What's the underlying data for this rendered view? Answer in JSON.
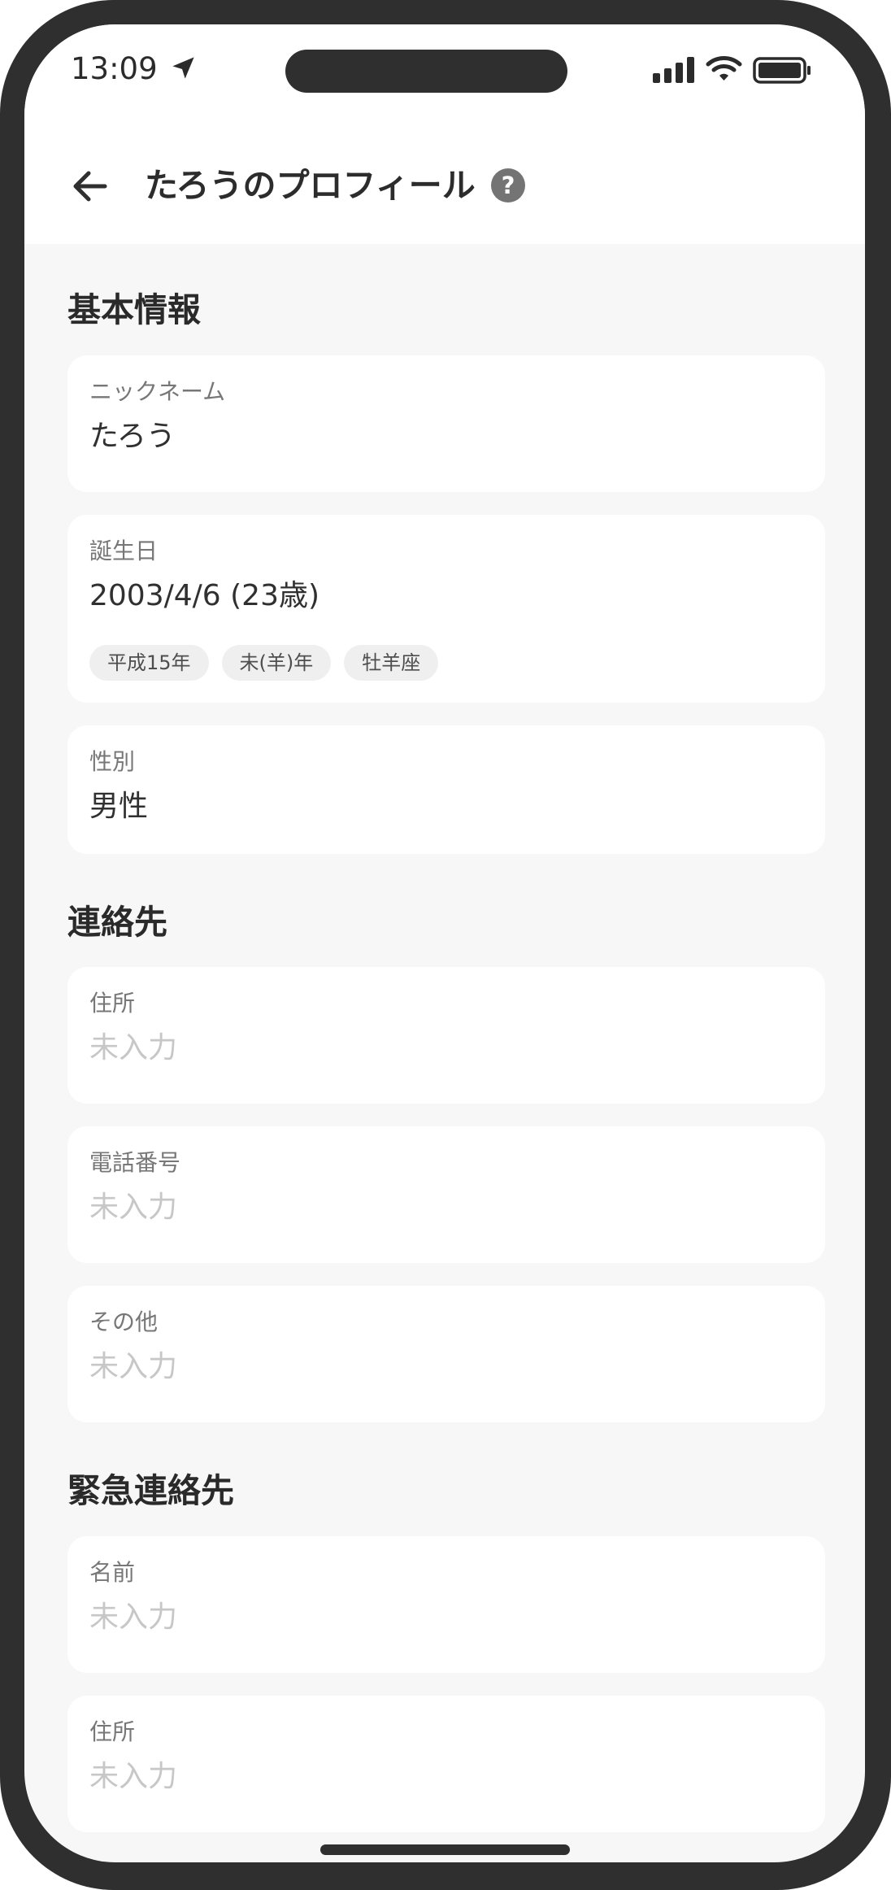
{
  "status_bar": {
    "time": "13:09",
    "location_icon": "location-arrow-icon",
    "signal_icon": "cellular-signal-icon",
    "wifi_icon": "wifi-icon",
    "battery_icon": "battery-full-icon"
  },
  "header": {
    "back_icon": "arrow-left-icon",
    "title": "たろうのプロフィール",
    "help_label": "?"
  },
  "sections": {
    "basic": {
      "heading": "基本情報",
      "nickname": {
        "label": "ニックネーム",
        "value": "たろう"
      },
      "birthday": {
        "label": "誕生日",
        "value": "2003/4/6 (23歳)",
        "chips": [
          "平成15年",
          "未(羊)年",
          "牡羊座"
        ]
      },
      "gender": {
        "label": "性別",
        "value": "男性"
      }
    },
    "contact": {
      "heading": "連絡先",
      "address": {
        "label": "住所",
        "value": "未入力"
      },
      "phone": {
        "label": "電話番号",
        "value": "未入力"
      },
      "other": {
        "label": "その他",
        "value": "未入力"
      }
    },
    "emergency": {
      "heading": "緊急連絡先",
      "name": {
        "label": "名前",
        "value": "未入力"
      },
      "address": {
        "label": "住所",
        "value": "未入力"
      }
    }
  },
  "colors": {
    "frame": "#2f2f2f",
    "background": "#f7f7f7",
    "card": "#ffffff",
    "placeholder_text": "#c7c7c7",
    "label_text": "#777777",
    "chip_background": "#efefef",
    "help_icon": "#747474"
  }
}
